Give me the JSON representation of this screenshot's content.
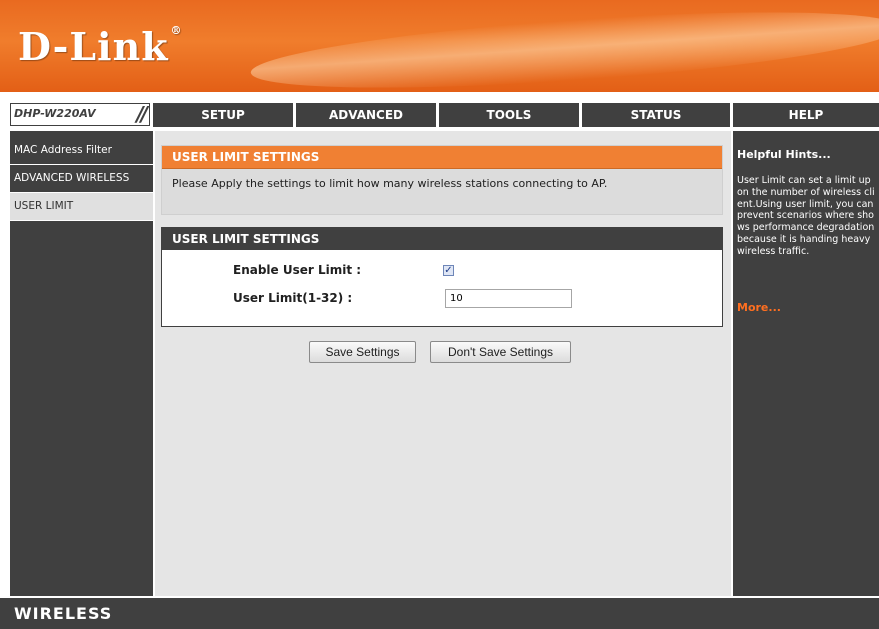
{
  "brand": {
    "logo_text": "D-Link",
    "trademark": "®",
    "model": "DHP-W220AV"
  },
  "nav": {
    "tabs": [
      {
        "label": "SETUP"
      },
      {
        "label": "ADVANCED"
      },
      {
        "label": "TOOLS"
      },
      {
        "label": "STATUS"
      },
      {
        "label": "HELP"
      }
    ]
  },
  "sidebar": {
    "items": [
      {
        "label": "MAC Address Filter",
        "active": false
      },
      {
        "label": "ADVANCED WIRELESS",
        "active": false
      },
      {
        "label": "USER LIMIT",
        "active": true
      }
    ]
  },
  "intro": {
    "title": "USER LIMIT SETTINGS",
    "text": "Please Apply the settings to limit how many wireless stations connecting to AP."
  },
  "settings": {
    "title": "USER LIMIT SETTINGS",
    "enable_label": "Enable User Limit :",
    "enable_checked": true,
    "limit_label": "User Limit(1-32) :",
    "limit_value": "10"
  },
  "buttons": {
    "save": "Save Settings",
    "dont_save": "Don't Save Settings"
  },
  "hints": {
    "title": "Helpful Hints...",
    "body": "User Limit can set a limit upon the number of wireless client.Using user limit, you can prevent scenarios where shows performance degradation because it is handing heavy wireless traffic.",
    "more": "More..."
  },
  "footer": {
    "label": "WIRELESS"
  },
  "colors": {
    "orange": "#f08033",
    "dark": "#404040",
    "content_bg": "#e5e5e5"
  }
}
